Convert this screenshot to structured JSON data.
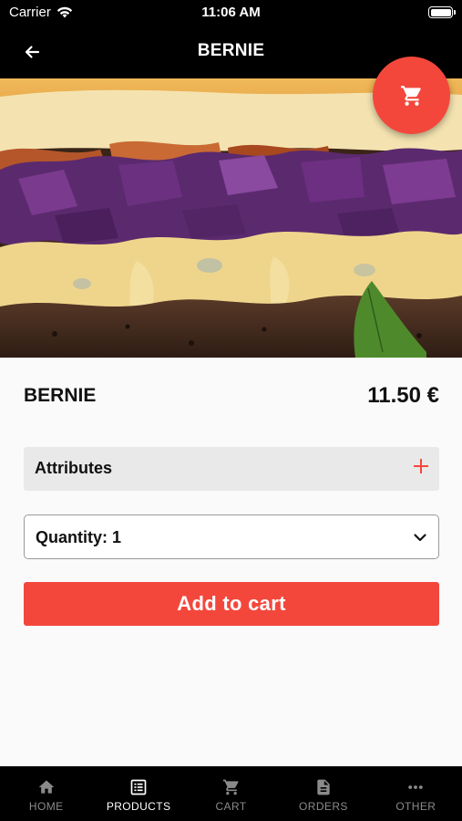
{
  "status_bar": {
    "carrier": "Carrier",
    "time": "11:06 AM",
    "wifi_icon": "wifi-icon",
    "battery_icon": "battery-icon"
  },
  "nav": {
    "title": "BERNIE",
    "back_icon": "arrow-left-icon"
  },
  "hero": {
    "image": "burger-photo"
  },
  "fab": {
    "icon": "cart-icon",
    "color": "#f4473c"
  },
  "product": {
    "name": "BERNIE",
    "price": "11.50 €"
  },
  "attributes": {
    "label": "Attributes",
    "icon": "plus-icon"
  },
  "quantity": {
    "label": "Quantity: 1",
    "icon": "chevron-down-icon"
  },
  "add_to_cart": {
    "label": "Add to cart",
    "color": "#f4473c"
  },
  "tabs": [
    {
      "label": "HOME",
      "icon": "home-icon",
      "active": false
    },
    {
      "label": "PRODUCTS",
      "icon": "list-icon",
      "active": true
    },
    {
      "label": "CART",
      "icon": "cart-icon",
      "active": false
    },
    {
      "label": "ORDERS",
      "icon": "document-icon",
      "active": false
    },
    {
      "label": "OTHER",
      "icon": "more-icon",
      "active": false
    }
  ]
}
